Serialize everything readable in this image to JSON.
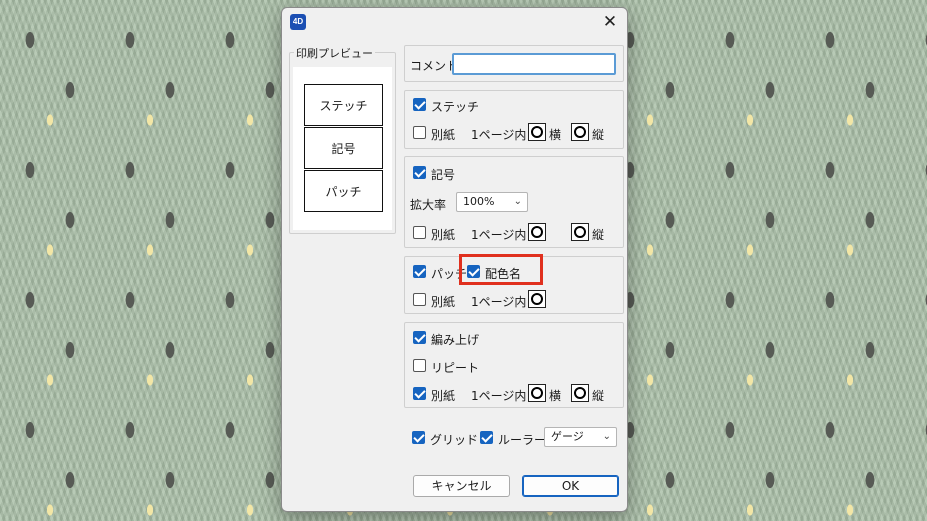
{
  "dialog": {
    "app_icon_label": "4D",
    "close_glyph": "✕"
  },
  "preview": {
    "legend": "印刷プレビュー",
    "buttons": [
      "ステッチ",
      "記号",
      "パッチ"
    ]
  },
  "comment": {
    "label": "コメント",
    "value": ""
  },
  "stitch": {
    "checkbox_label": "ステッチ",
    "checked": true,
    "separate_label": "別紙",
    "separate_checked": false,
    "one_page_label": "1ページ内",
    "landscape_label": "横",
    "portrait_label": "縦"
  },
  "symbol": {
    "checkbox_label": "記号",
    "checked": true,
    "zoom_label": "拡大率",
    "zoom_value": "100%",
    "separate_label": "別紙",
    "separate_checked": false,
    "one_page_label": "1ページ内",
    "portrait_label": "縦"
  },
  "patch": {
    "checkbox_label": "パッチ",
    "checked": true,
    "color_name_label": "配色名",
    "color_name_checked": true,
    "separate_label": "別紙",
    "separate_checked": false,
    "one_page_label": "1ページ内"
  },
  "finished": {
    "checkbox_label": "編み上げ",
    "checked": true,
    "repeat_label": "リピート",
    "repeat_checked": false,
    "separate_label": "別紙",
    "separate_checked": true,
    "one_page_label": "1ページ内",
    "landscape_label": "横",
    "portrait_label": "縦"
  },
  "footer_options": {
    "grid_label": "グリッド",
    "grid_checked": true,
    "ruler_label": "ルーラー",
    "ruler_checked": true,
    "ruler_select_value": "ゲージ"
  },
  "buttons": {
    "cancel": "キャンセル",
    "ok": "OK"
  },
  "colors": {
    "accent": "#1664c0",
    "highlight": "#e0301e"
  }
}
